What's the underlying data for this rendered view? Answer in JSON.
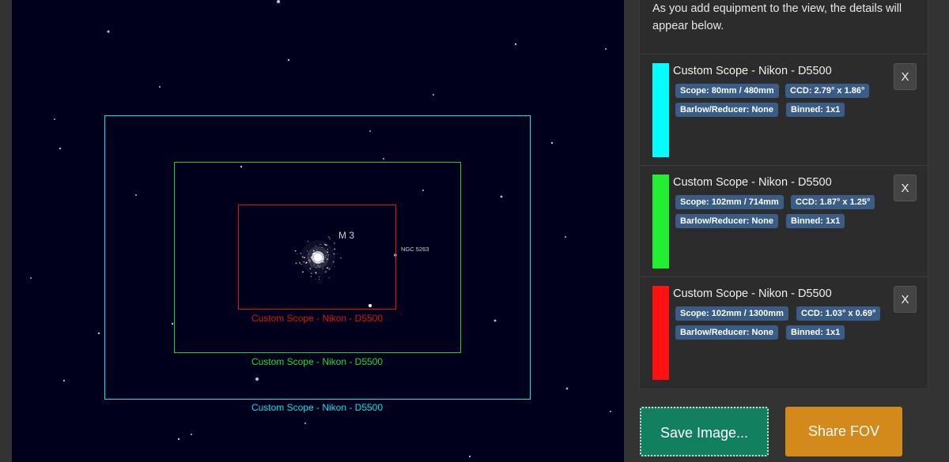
{
  "sky": {
    "target_label": "M 3",
    "nearby_label": "NGC 5263",
    "fov_labels": [
      {
        "text": "Custom Scope - Nikon - D5500",
        "color": "#00e5e5"
      },
      {
        "text": "Custom Scope - Nikon - D5500",
        "color": "#22dd22"
      },
      {
        "text": "Custom Scope - Nikon - D5500",
        "color": "#dd1111"
      }
    ]
  },
  "panel": {
    "intro": "As you add equipment to the view, the details will appear below.",
    "remove_label": "X",
    "items": [
      {
        "title": "Custom Scope - Nikon - D5500",
        "color": "#00ffff",
        "scope": "Scope: 80mm / 480mm",
        "ccd": "CCD: 2.79° x 1.86°",
        "barlow": "Barlow/Reducer: None",
        "binned": "Binned: 1x1"
      },
      {
        "title": "Custom Scope - Nikon - D5500",
        "color": "#22ee33",
        "scope": "Scope: 102mm / 714mm",
        "ccd": "CCD: 1.87° x 1.25°",
        "barlow": "Barlow/Reducer: None",
        "binned": "Binned: 1x1"
      },
      {
        "title": "Custom Scope - Nikon - D5500",
        "color": "#ff1111",
        "scope": "Scope: 102mm / 1300mm",
        "ccd": "CCD: 1.03° x 0.69°",
        "barlow": "Barlow/Reducer: None",
        "binned": "Binned: 1x1"
      }
    ]
  },
  "buttons": {
    "save": "Save Image...",
    "share": "Share FOV"
  }
}
